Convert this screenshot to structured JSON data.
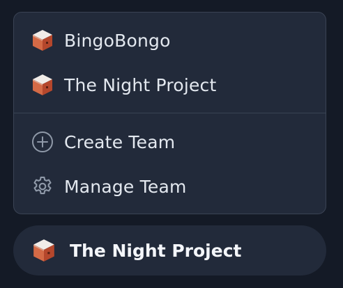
{
  "menu": {
    "teams": [
      {
        "label": "BingoBongo",
        "icon": "team-cube-icon"
      },
      {
        "label": "The Night Project",
        "icon": "team-cube-icon"
      }
    ],
    "actions": [
      {
        "label": "Create Team",
        "icon": "plus-circle-icon"
      },
      {
        "label": "Manage Team",
        "icon": "gear-icon"
      }
    ]
  },
  "current_team": {
    "label": "The Night Project",
    "icon": "team-cube-icon"
  },
  "colors": {
    "background": "#141a26",
    "panel": "#222a3a",
    "border": "#3a4354",
    "text": "#e3e8ef",
    "cube_top": "#f1ece8",
    "cube_left": "#d46a46",
    "cube_right": "#b5472c"
  }
}
